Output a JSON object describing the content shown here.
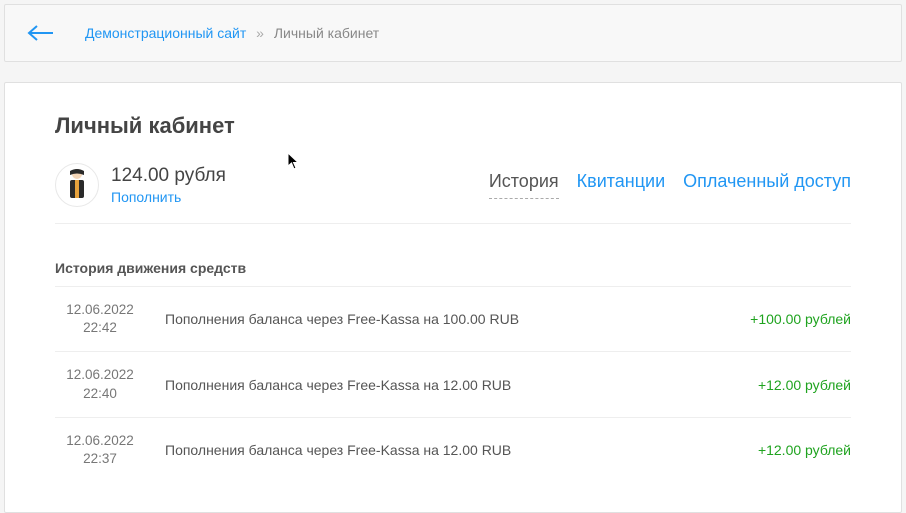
{
  "breadcrumb": {
    "site_link": "Демонстрационный сайт",
    "separator": "»",
    "current": "Личный кабинет"
  },
  "page_title": "Личный кабинет",
  "balance": {
    "amount": "124.00 рубля",
    "topup_label": "Пополнить"
  },
  "tabs": {
    "history": "История",
    "receipts": "Квитанции",
    "paid_access": "Оплаченный доступ"
  },
  "section_title": "История движения средств",
  "transactions": [
    {
      "date": "12.06.2022",
      "time": "22:42",
      "description": "Пополнения баланса через Free-Kassa на 100.00 RUB",
      "amount": "+100.00 рублей"
    },
    {
      "date": "12.06.2022",
      "time": "22:40",
      "description": "Пополнения баланса через Free-Kassa на 12.00 RUB",
      "amount": "+12.00 рублей"
    },
    {
      "date": "12.06.2022",
      "time": "22:37",
      "description": "Пополнения баланса через Free-Kassa на 12.00 RUB",
      "amount": "+12.00 рублей"
    }
  ]
}
